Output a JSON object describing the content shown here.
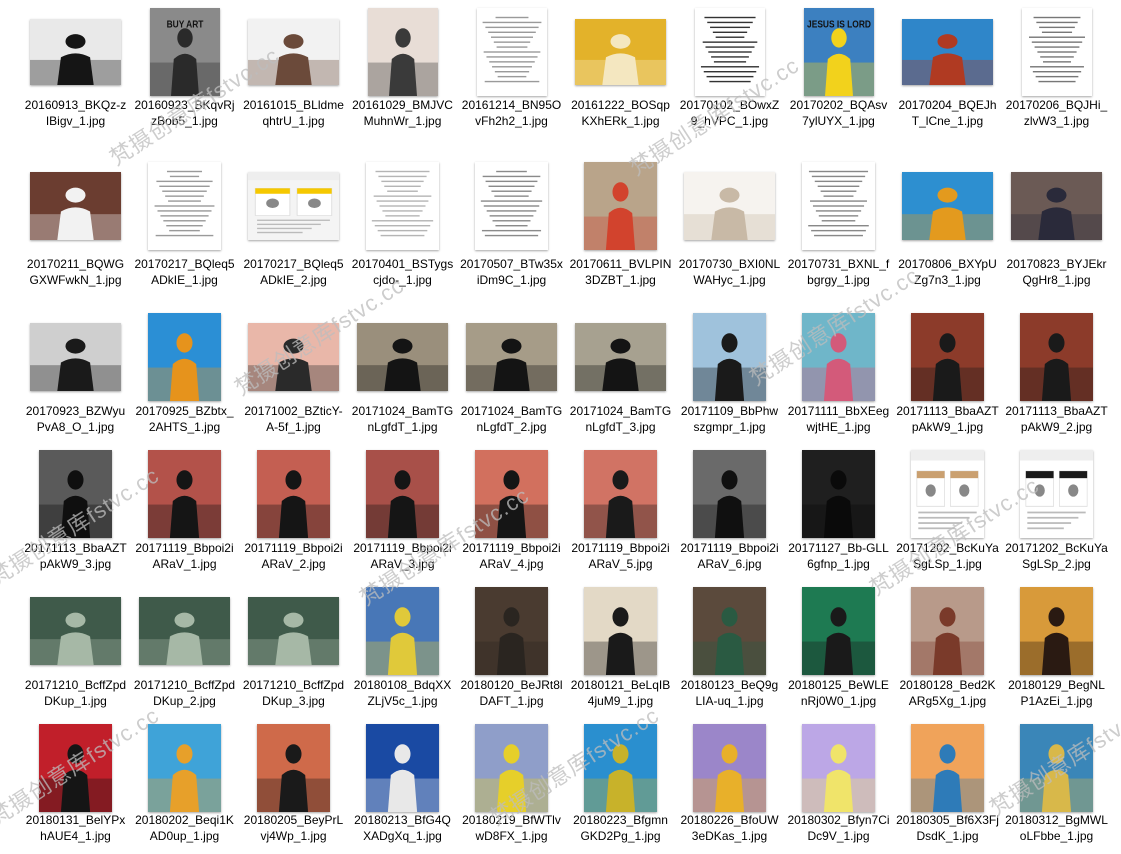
{
  "files": [
    {
      "name": "20160913_BKQz-zIBigv_1.jpg",
      "orient": "l",
      "kind": "photo",
      "bg": "#e9e9e9",
      "fg": "#151515"
    },
    {
      "name": "20160923_BKqvRjzBob5_1.jpg",
      "orient": "s",
      "kind": "photo",
      "bg": "#8a8a8a",
      "fg": "#2a2a2a",
      "tag": "BUY ART"
    },
    {
      "name": "20161015_BLldmeqhtrU_1.jpg",
      "orient": "l",
      "kind": "photo",
      "bg": "#f2f2f2",
      "fg": "#6b4a3a"
    },
    {
      "name": "20161029_BMJVCMuhnWr_1.jpg",
      "orient": "s",
      "kind": "photo",
      "bg": "#e8ddd6",
      "fg": "#3a3a3a"
    },
    {
      "name": "20161214_BN95OvFh2h2_1.jpg",
      "orient": "s",
      "kind": "text",
      "bg": "#ffffff",
      "fg": "#9a9a9a"
    },
    {
      "name": "20161222_BOSqpKXhERk_1.jpg",
      "orient": "l",
      "kind": "photo",
      "bg": "#e3b22a",
      "fg": "#f4e7c0"
    },
    {
      "name": "20170102_BOwxZ9_hVPC_1.jpg",
      "orient": "s",
      "kind": "text",
      "bg": "#ffffff",
      "fg": "#333333"
    },
    {
      "name": "20170202_BQAsv7ylUYX_1.jpg",
      "orient": "s",
      "kind": "photo",
      "bg": "#3c80c0",
      "fg": "#f2d21c",
      "tag": "JESUS IS LORD"
    },
    {
      "name": "20170204_BQEJhT_lCne_1.jpg",
      "orient": "l",
      "kind": "photo",
      "bg": "#2f86c9",
      "fg": "#b03a22"
    },
    {
      "name": "20170206_BQJHi_zlvW3_1.jpg",
      "orient": "s",
      "kind": "text",
      "bg": "#ffffff",
      "fg": "#777777"
    },
    {
      "name": "20170211_BQWGGXWFwkN_1.jpg",
      "orient": "l",
      "kind": "photo",
      "bg": "#6b3d30",
      "fg": "#f2f2f2"
    },
    {
      "name": "20170217_BQleq5ADkIE_1.jpg",
      "orient": "s",
      "kind": "text",
      "bg": "#ffffff",
      "fg": "#9a9a9a"
    },
    {
      "name": "20170217_BQleq5ADkIE_2.jpg",
      "orient": "l",
      "kind": "ui",
      "bg": "#f4f4f4",
      "fg": "#f5c800"
    },
    {
      "name": "20170401_BSTygscjdo-_1.jpg",
      "orient": "s",
      "kind": "text",
      "bg": "#ffffff",
      "fg": "#b5b5b5"
    },
    {
      "name": "20170507_BTw35xiDm9C_1.jpg",
      "orient": "s",
      "kind": "text",
      "bg": "#ffffff",
      "fg": "#8a8a8a"
    },
    {
      "name": "20170611_BVLPIN3DZBT_1.jpg",
      "orient": "s",
      "kind": "photo",
      "bg": "#b9a48a",
      "fg": "#d2432d"
    },
    {
      "name": "20170730_BXI0NLWAHyc_1.jpg",
      "orient": "l",
      "kind": "photo",
      "bg": "#f6f3ef",
      "fg": "#c8b9a6"
    },
    {
      "name": "20170731_BXNL_fbgrgy_1.jpg",
      "orient": "s",
      "kind": "text",
      "bg": "#ffffff",
      "fg": "#888888"
    },
    {
      "name": "20170806_BXYpUZg7n3_1.jpg",
      "orient": "l",
      "kind": "photo",
      "bg": "#2d8fd0",
      "fg": "#e39a1e"
    },
    {
      "name": "20170823_BYJEkrQgHr8_1.jpg",
      "orient": "l",
      "kind": "photo",
      "bg": "#6b5a55",
      "fg": "#2a2a3a"
    },
    {
      "name": "20170923_BZWyuPvA8_O_1.jpg",
      "orient": "l",
      "kind": "photo",
      "bg": "#cfcfcf",
      "fg": "#1a1a1a"
    },
    {
      "name": "20170925_BZbtx_2AHTS_1.jpg",
      "orient": "s",
      "kind": "photo",
      "bg": "#2b8fd5",
      "fg": "#e6931c"
    },
    {
      "name": "20171002_BZticY-A-5f_1.jpg",
      "orient": "l",
      "kind": "photo",
      "bg": "#e9b7a9",
      "fg": "#2a2a2a"
    },
    {
      "name": "20171024_BamTGnLgfdT_1.jpg",
      "orient": "l",
      "kind": "photo",
      "bg": "#9a8f7c",
      "fg": "#141414"
    },
    {
      "name": "20171024_BamTGnLgfdT_2.jpg",
      "orient": "l",
      "kind": "photo",
      "bg": "#a69c88",
      "fg": "#141414"
    },
    {
      "name": "20171024_BamTGnLgfdT_3.jpg",
      "orient": "l",
      "kind": "photo",
      "bg": "#a7a190",
      "fg": "#141414"
    },
    {
      "name": "20171109_BbPhwszgmpr_1.jpg",
      "orient": "s",
      "kind": "photo",
      "bg": "#9fc2dc",
      "fg": "#1a1a1a"
    },
    {
      "name": "20171111_BbXEegwjtHE_1.jpg",
      "orient": "s",
      "kind": "photo",
      "bg": "#6fb6c9",
      "fg": "#d35a7a"
    },
    {
      "name": "20171113_BbaAZTpAkW9_1.jpg",
      "orient": "s",
      "kind": "photo",
      "bg": "#8c3b2a",
      "fg": "#1a1a1a"
    },
    {
      "name": "20171113_BbaAZTpAkW9_2.jpg",
      "orient": "s",
      "kind": "photo",
      "bg": "#8c3b2a",
      "fg": "#1a1a1a"
    },
    {
      "name": "20171113_BbaAZTpAkW9_3.jpg",
      "orient": "s",
      "kind": "photo",
      "bg": "#5a5a5a",
      "fg": "#0f0f0f"
    },
    {
      "name": "20171119_Bbpoi2iARaV_1.jpg",
      "orient": "s",
      "kind": "photo",
      "bg": "#b3524a",
      "fg": "#151515"
    },
    {
      "name": "20171119_Bbpoi2iARaV_2.jpg",
      "orient": "s",
      "kind": "photo",
      "bg": "#c45f52",
      "fg": "#151515"
    },
    {
      "name": "20171119_Bbpoi2iARaV_3.jpg",
      "orient": "s",
      "kind": "photo",
      "bg": "#a85049",
      "fg": "#151515"
    },
    {
      "name": "20171119_Bbpoi2iARaV_4.jpg",
      "orient": "s",
      "kind": "photo",
      "bg": "#d2705e",
      "fg": "#151515"
    },
    {
      "name": "20171119_Bbpoi2iARaV_5.jpg",
      "orient": "s",
      "kind": "photo",
      "bg": "#d17364",
      "fg": "#1a1a1a"
    },
    {
      "name": "20171119_Bbpoi2iARaV_6.jpg",
      "orient": "s",
      "kind": "photo",
      "bg": "#6a6a6a",
      "fg": "#101010"
    },
    {
      "name": "20171127_Bb-GLL6gfnp_1.jpg",
      "orient": "s",
      "kind": "photo",
      "bg": "#1f1f1f",
      "fg": "#0a0a0a"
    },
    {
      "name": "20171202_BcKuYaSgLSp_1.jpg",
      "orient": "s",
      "kind": "ui",
      "bg": "#ffffff",
      "fg": "#caa070"
    },
    {
      "name": "20171202_BcKuYaSgLSp_2.jpg",
      "orient": "s",
      "kind": "ui",
      "bg": "#ffffff",
      "fg": "#1a1a1a"
    },
    {
      "name": "20171210_BcffZpdDKup_1.jpg",
      "orient": "l",
      "kind": "photo",
      "bg": "#3f5a4a",
      "fg": "#a6b8a6"
    },
    {
      "name": "20171210_BcffZpdDKup_2.jpg",
      "orient": "l",
      "kind": "photo",
      "bg": "#3f5a4a",
      "fg": "#a6b8a6"
    },
    {
      "name": "20171210_BcffZpdDKup_3.jpg",
      "orient": "l",
      "kind": "photo",
      "bg": "#3f5a4a",
      "fg": "#a6b8a6"
    },
    {
      "name": "20180108_BdqXXZLjV5c_1.jpg",
      "orient": "s",
      "kind": "photo",
      "bg": "#4877b7",
      "fg": "#e0c93a"
    },
    {
      "name": "20180120_BeJRt8lDAFT_1.jpg",
      "orient": "s",
      "kind": "photo",
      "bg": "#4a3b30",
      "fg": "#2a2520"
    },
    {
      "name": "20180121_BeLqIB4juM9_1.jpg",
      "orient": "s",
      "kind": "photo",
      "bg": "#e3d9c6",
      "fg": "#1a1a1a"
    },
    {
      "name": "20180123_BeQ9gLIA-uq_1.jpg",
      "orient": "s",
      "kind": "photo",
      "bg": "#5b4a3c",
      "fg": "#2a5a42"
    },
    {
      "name": "20180125_BeWLEnRj0W0_1.jpg",
      "orient": "s",
      "kind": "photo",
      "bg": "#1e7a52",
      "fg": "#1a1a1a"
    },
    {
      "name": "20180128_Bed2KARg5Xg_1.jpg",
      "orient": "s",
      "kind": "photo",
      "bg": "#b89a8a",
      "fg": "#7a3a2a"
    },
    {
      "name": "20180129_BegNLP1AzEi_1.jpg",
      "orient": "s",
      "kind": "photo",
      "bg": "#d89a3a",
      "fg": "#2a1a12"
    },
    {
      "name": "20180131_BelYPxhAUE4_1.jpg",
      "orient": "s",
      "kind": "photo",
      "bg": "#c11f2a",
      "fg": "#151515"
    },
    {
      "name": "20180202_Beqi1KAD0up_1.jpg",
      "orient": "s",
      "kind": "photo",
      "bg": "#3fa3d8",
      "fg": "#e7a02a"
    },
    {
      "name": "20180205_BeyPrLvj4Wp_1.jpg",
      "orient": "s",
      "kind": "photo",
      "bg": "#cf6a4a",
      "fg": "#1a1a1a"
    },
    {
      "name": "20180213_BfG4QXADgXq_1.jpg",
      "orient": "s",
      "kind": "photo",
      "bg": "#1a4aa3",
      "fg": "#e8e8e8"
    },
    {
      "name": "20180219_BfWTlvwD8FX_1.jpg",
      "orient": "s",
      "kind": "photo",
      "bg": "#8f9ec9",
      "fg": "#e6cf2a"
    },
    {
      "name": "20180223_BfgmnGKD2Pg_1.jpg",
      "orient": "s",
      "kind": "photo",
      "bg": "#2a8fcf",
      "fg": "#c8b22a"
    },
    {
      "name": "20180226_BfoUW3eDKas_1.jpg",
      "orient": "s",
      "kind": "photo",
      "bg": "#9b86c9",
      "fg": "#e8b02a"
    },
    {
      "name": "20180302_Bfyn7CiDc9V_1.jpg",
      "orient": "s",
      "kind": "photo",
      "bg": "#bca7e6",
      "fg": "#f0e46a"
    },
    {
      "name": "20180305_Bf6X3FjDsdK_1.jpg",
      "orient": "s",
      "kind": "photo",
      "bg": "#f0a35a",
      "fg": "#2e7bb8"
    },
    {
      "name": "20180312_BgMWLoLFbbe_1.jpg",
      "orient": "s",
      "kind": "photo",
      "bg": "#3a86b8",
      "fg": "#d8b84a"
    }
  ],
  "watermark": {
    "text": "梵摄创意库fstvc.cc"
  }
}
